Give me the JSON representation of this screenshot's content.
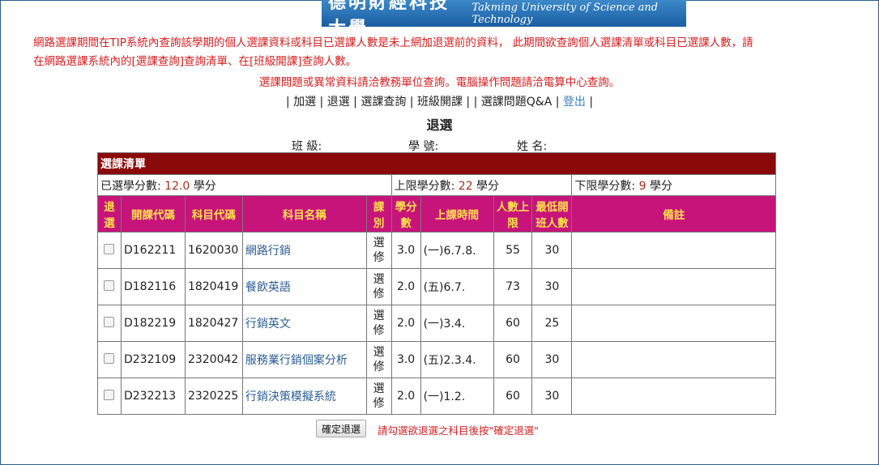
{
  "banner": {
    "name_cn": "德明財經科技大學",
    "name_en": "Takming University of Science and Technology"
  },
  "notice": {
    "line1": "網路選課期間在TIP系統內查詢該學期的個人選課資料或科目已選課人數是未上網加退選前的資料， 此期間欲查詢個人選課清單或科目已選課人數，請",
    "line2": "在網路選課系統內的[選課查詢]查詢清單、在[班級開課]查詢人數。",
    "contact": "選課問題或異常資料請洽教務單位查詢。電腦操作問題請洽電算中心查詢。"
  },
  "nav": {
    "sep": "|",
    "add": "加選",
    "drop": "退選",
    "query": "選課查詢",
    "class_courses": "班級開課",
    "qa": "選課問題Q&A",
    "logout": "登出"
  },
  "page_title": "退選",
  "student": {
    "class_label": "班 級:",
    "id_label": "學 號:",
    "name_label": "姓 名:"
  },
  "list": {
    "caption": "選課清單",
    "selected_label": "已選學分數: ",
    "selected_value": "12.0",
    "upper_label": "上限學分數: ",
    "upper_value": "22",
    "lower_label": "下限學分數: ",
    "lower_value": "9",
    "unit": " 學分"
  },
  "columns": {
    "drop": "退選",
    "offer_code": "開課代碼",
    "course_code": "科目代碼",
    "course_name": "科目名稱",
    "kind": "課別",
    "credits": "學分數",
    "time": "上課時間",
    "cap": "人數上限",
    "min": "最低開班人數",
    "note": "備註"
  },
  "rows": [
    {
      "offer": "D162211",
      "code": "1620030",
      "name": "網路行銷",
      "kind": "選修",
      "credits": "3.0",
      "time": "(一)6.7.8.",
      "cap": "55",
      "min": "30",
      "note": ""
    },
    {
      "offer": "D182116",
      "code": "1820419",
      "name": "餐飲英語",
      "kind": "選修",
      "credits": "2.0",
      "time": "(五)6.7.",
      "cap": "73",
      "min": "30",
      "note": ""
    },
    {
      "offer": "D182219",
      "code": "1820427",
      "name": "行銷英文",
      "kind": "選修",
      "credits": "2.0",
      "time": "(一)3.4.",
      "cap": "60",
      "min": "25",
      "note": ""
    },
    {
      "offer": "D232109",
      "code": "2320042",
      "name": "服務業行銷個案分析",
      "kind": "選修",
      "credits": "3.0",
      "time": "(五)2.3.4.",
      "cap": "60",
      "min": "30",
      "note": ""
    },
    {
      "offer": "D232213",
      "code": "2320225",
      "name": "行銷決策模擬系統",
      "kind": "選修",
      "credits": "2.0",
      "time": "(一)1.2.",
      "cap": "60",
      "min": "30",
      "note": ""
    }
  ],
  "actions": {
    "confirm": "確定退選",
    "hint": "請勾選欲退選之科目後按\"確定退選\""
  },
  "colors": {
    "caption_bg": "#8a0a0a",
    "header_bg": "#c7147a",
    "header_text": "#ffe24a",
    "notice_text": "#d81e1e",
    "link": "#2a5d96"
  }
}
